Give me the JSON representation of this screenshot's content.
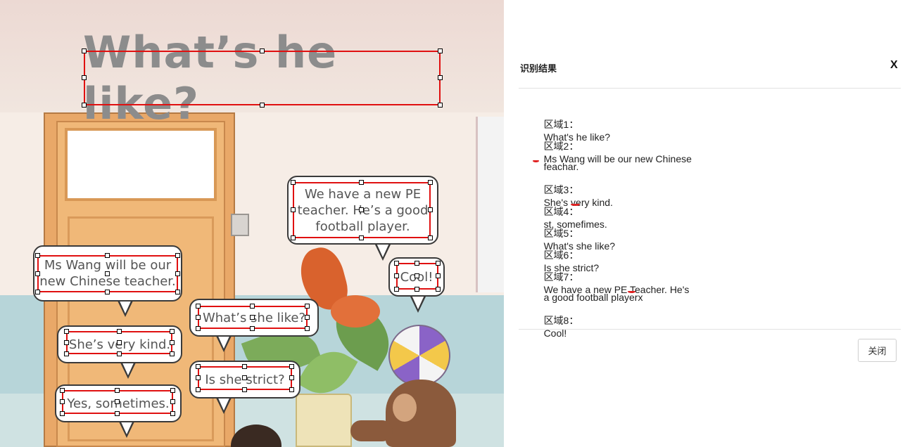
{
  "scene": {
    "title": "What’s he like?",
    "bubbles": {
      "wang_line1": "Ms Wang will be our",
      "wang_line2": "new Chinese teacher.",
      "kind": "She’s very kind.",
      "sometimes": "Yes, sometimes.",
      "whats_she": "What’s she like?",
      "strict": "Is she strict?",
      "pe_line1": "We have a new PE",
      "pe_line2": "teacher. He’s a good",
      "pe_line3": "football player.",
      "cool": "Cool!"
    }
  },
  "dialog": {
    "title": "识别结果",
    "close_x": "X",
    "close_button": "关闭",
    "results": [
      {
        "label": "区域1：",
        "text": "What's he like?"
      },
      {
        "label": "区域2：",
        "text": "Ms Wang will be our new Chinese",
        "continuation": "feachar."
      },
      {
        "label": "区域3：",
        "text": "She's very kind."
      },
      {
        "label": "区域4：",
        "text": "st, somefimes."
      },
      {
        "label": "区域5：",
        "text": "What's she like?"
      },
      {
        "label": "区域6：",
        "text": "Is she strict?"
      },
      {
        "label": "区域7：",
        "text": "We have a new PE Teacher. He's",
        "continuation": "a good football playerx"
      },
      {
        "label": "区域8：",
        "text": "Cool!"
      }
    ]
  },
  "colors": {
    "ocr_box": "#e01010",
    "title_text": "#8c8c8c",
    "error_underline": "#e02020"
  }
}
